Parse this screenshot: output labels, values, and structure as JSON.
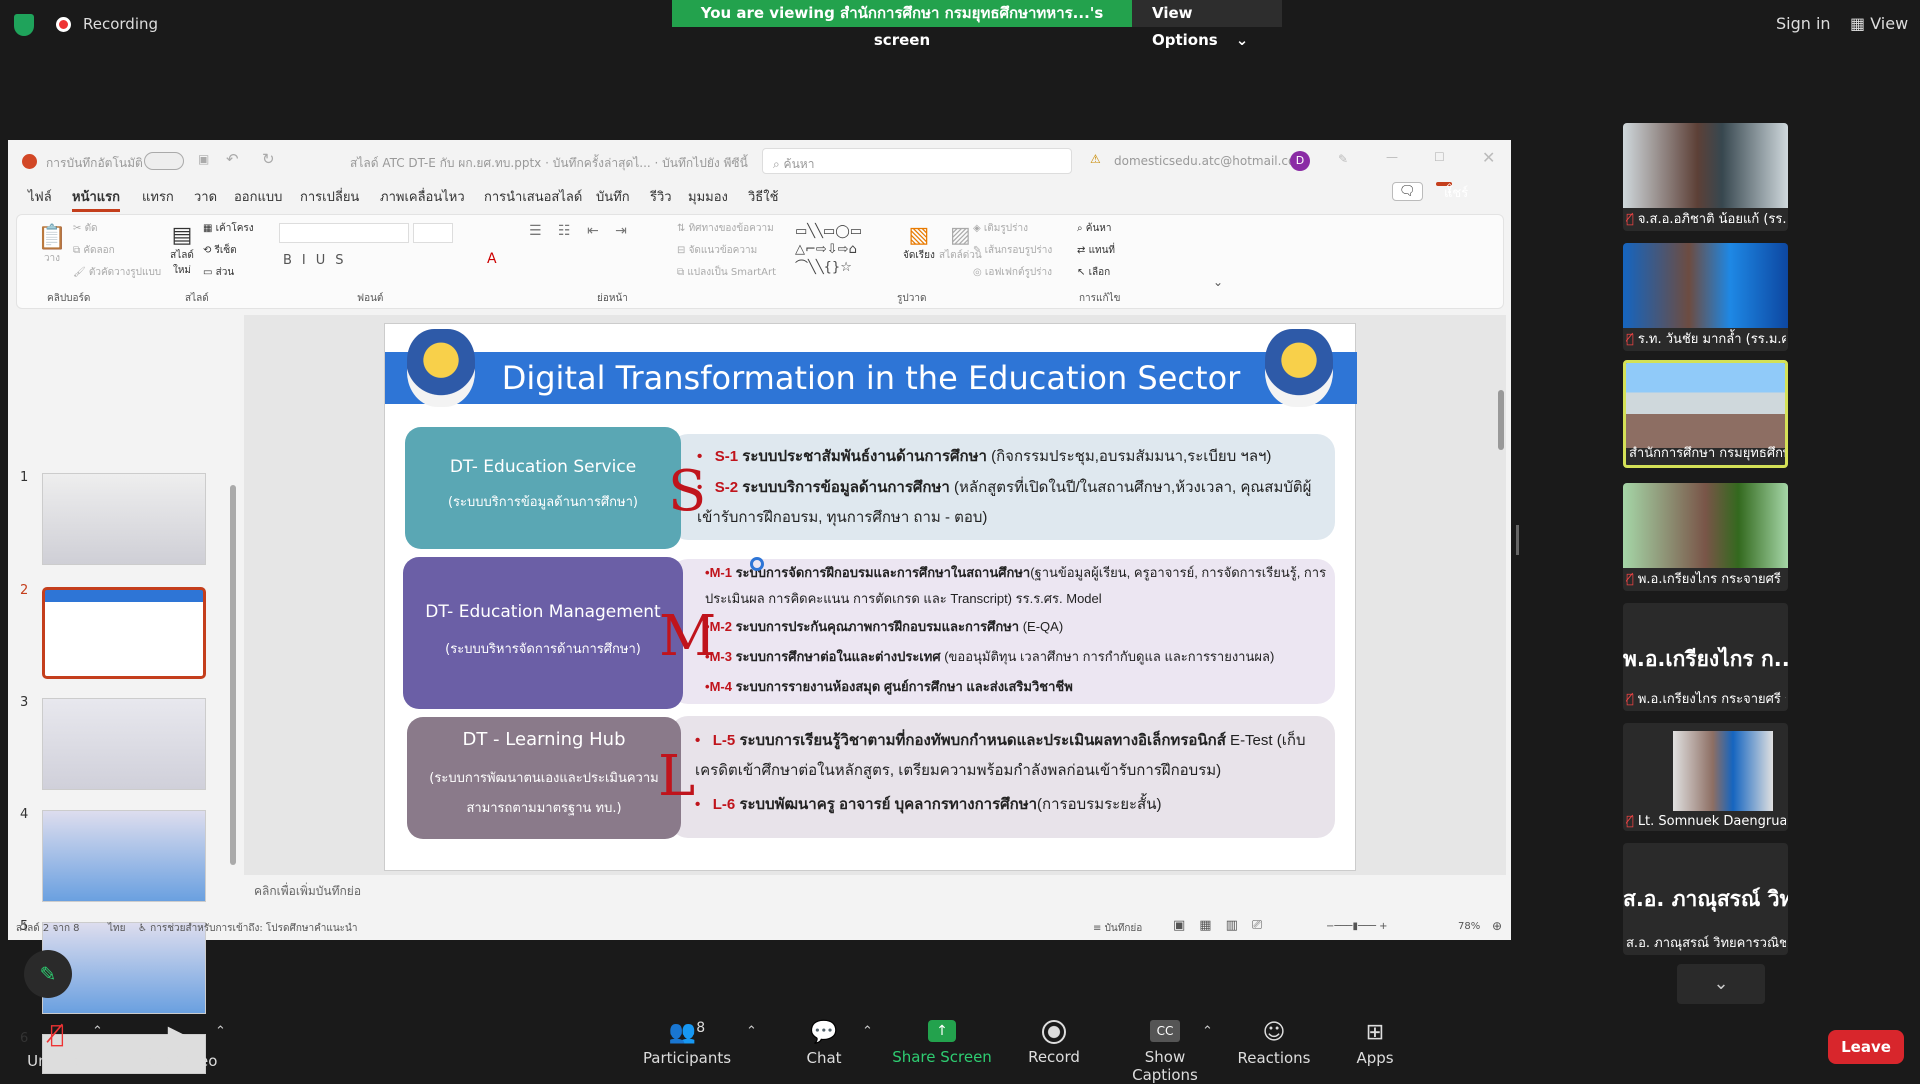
{
  "zoom_top": {
    "recording_label": "Recording",
    "viewing_banner": "You are viewing สำนักการศึกษา กรมยุทธศึกษาทหาร...'s screen",
    "view_options": "View Options",
    "sign_in": "Sign in",
    "view": "View"
  },
  "ppt": {
    "autosave": "การบันทึกอัตโนมัติ",
    "file_title": "สไลด์ ATC DT-E กับ ผก.ยศ.ทบ.pptx  ·  บันทึกครั้งล่าสุดไ...  ·  บันทึกไปยัง พีซีนี้",
    "search_placeholder": "ค้นหา",
    "account": "domesticsedu.atc@hotmail.com",
    "avatar_letter": "D",
    "share_label": "แชร์",
    "tabs": [
      "ไฟล์",
      "หน้าแรก",
      "แทรก",
      "วาด",
      "ออกแบบ",
      "การเปลี่ยน",
      "ภาพเคลื่อนไหว",
      "การนำเสนอสไลด์",
      "บันทึก",
      "รีวิว",
      "มุมมอง",
      "วิธีใช้"
    ],
    "ribbon_groups": [
      "คลิปบอร์ด",
      "สไลด์",
      "ฟอนต์",
      "ย่อหน้า",
      "รูปวาด",
      "การแก้ไข"
    ],
    "ribbon_items": {
      "paste": "วาง",
      "cut": "ตัด",
      "copy": "คัดลอก",
      "format_painter": "ตัวคัดวางรูปแบบ",
      "new_slide": "สไลด์ใหม่",
      "layout": "เค้าโครง",
      "reset": "รีเซ็ต",
      "section": "ส่วน",
      "find": "ค้นหา",
      "replace": "แทนที่",
      "select": "เลือก",
      "arrange": "จัดเรียง",
      "quick_styles": "สไตล์ด่วน",
      "text_direction": "ทิศทางของข้อความ",
      "align_text": "จัดแนวข้อความ",
      "smartart": "แปลงเป็น SmartArt",
      "shape_fill": "เติมรูปร่าง",
      "shape_outline": "เส้นกรอบรูปร่าง",
      "shape_effects": "เอฟเฟกต์รูปร่าง"
    },
    "slide_numbers": [
      "1",
      "2",
      "3",
      "4",
      "5",
      "6"
    ],
    "notes_placeholder": "คลิกเพื่อเพิ่มบันทึกย่อ",
    "status_slide": "สไลด์ 2 จาก 8",
    "status_lang": "ไทย",
    "status_access": "การช่วยสำหรับการเข้าถึง: โปรดศึกษาคำแนะนำ",
    "status_notes": "บันทึกย่อ",
    "zoom": "78%"
  },
  "slide": {
    "title": "Digital Transformation in the Education  Sector",
    "sections": [
      {
        "box_title": "DT- Education  Service",
        "box_sub": "(ระบบบริการข้อมูลด้านการศึกษา)",
        "letter": "S",
        "items": [
          {
            "code": "S-1",
            "bold": "ระบบประชาสัมพันธ์งานด้านการศึกษา",
            "rest": " (กิจกรรมประชุม,อบรมสัมมนา,ระเบียบ ฯลฯ)"
          },
          {
            "code": "S-2",
            "bold": "ระบบบริการข้อมูลด้านการศึกษา",
            "rest": " (หลักสูตรที่เปิดในปี/ในสถานศึกษา,ห้วงเวลา, คุณสมบัติผู้เข้ารับการฝึกอบรม, ทุนการศึกษา ถาม - ตอบ)"
          }
        ]
      },
      {
        "box_title": "DT- Education  Management",
        "box_sub": "(ระบบบริหารจัดการด้านการศึกษา)",
        "letter": "M",
        "items": [
          {
            "code": "M-1",
            "bold": "ระบบการจัดการฝึกอบรมและการศึกษาในสถานศึกษา",
            "rest": "(ฐานข้อมูลผู้เรียน, ครูอาจารย์, การจัดการเรียนรู้, การประเมินผล การคิดคะแนน การตัดเกรด และ Transcript)     รร.ร.ศร. Model"
          },
          {
            "code": "M-2",
            "bold": "ระบบการประกันคุณภาพการฝึกอบรมและการศึกษา",
            "rest": " (E-QA)"
          },
          {
            "code": "M-3",
            "bold": "ระบบการศึกษาต่อในและต่างประเทศ",
            "rest": " (ขออนุมัติทุน เวลาศึกษา การกำกับดูแล และการรายงานผล)"
          },
          {
            "code": "M-4",
            "bold": "ระบบการรายงานห้องสมุด ศูนย์การศึกษา และส่งเสริมวิชาชีพ",
            "rest": ""
          }
        ]
      },
      {
        "box_title": "DT - Learning Hub",
        "box_sub": "(ระบบการพัฒนาตนเองและประเมินความสามารถตามมาตรฐาน ทบ.)",
        "letter": "L",
        "items": [
          {
            "code": "L-5",
            "bold": "ระบบการเรียนรู้วิชาตามที่กองทัพบกกำหนดและประเมินผลทางอิเล็กทรอนิกส์",
            "rest": " E-Test (เก็บเครดิตเข้าศึกษาต่อในหลักสูตร, เตรียมความพร้อมกำลังพลก่อนเข้ารับการฝึกอบรม)"
          },
          {
            "code": "L-6",
            "bold": "ระบบพัฒนาครู อาจารย์ บุคลากรทางการศึกษา",
            "rest": "(การอบรมระยะสั้น)"
          }
        ]
      }
    ]
  },
  "participants": [
    {
      "name": "จ.ส.อ.อภิชาติ  น้อยแก้ (รร...",
      "type": "video"
    },
    {
      "name": "ร.ท. วันชัย  มากล้ำ (รร.ม.ศ...",
      "type": "video"
    },
    {
      "name": "สำนักการศึกษา กรมยุทธศึกษา...",
      "type": "video-active"
    },
    {
      "name": "พ.อ.เกรียงไกร กระจายศรี อ...",
      "type": "video"
    },
    {
      "name": "พ.อ.เกรียงไกร กระจายศรี ร...",
      "big": "พ.อ.เกรียงไกร ก...",
      "type": "name"
    },
    {
      "name": "Lt. Somnuek Daengrua...",
      "type": "video-small"
    },
    {
      "name": "ส.อ. ภาณุสรณ์ วิทยคารวณิชผล",
      "big": "ส.อ. ภาณุสรณ์ วิท...",
      "type": "name-nomic"
    }
  ],
  "toolbar": {
    "unmute": "Unmute",
    "stop_video": "Stop Video",
    "participants": "Participants",
    "participants_count": "8",
    "chat": "Chat",
    "share": "Share Screen",
    "record": "Record",
    "captions": "Show Captions",
    "reactions": "Reactions",
    "apps": "Apps",
    "leave": "Leave"
  }
}
